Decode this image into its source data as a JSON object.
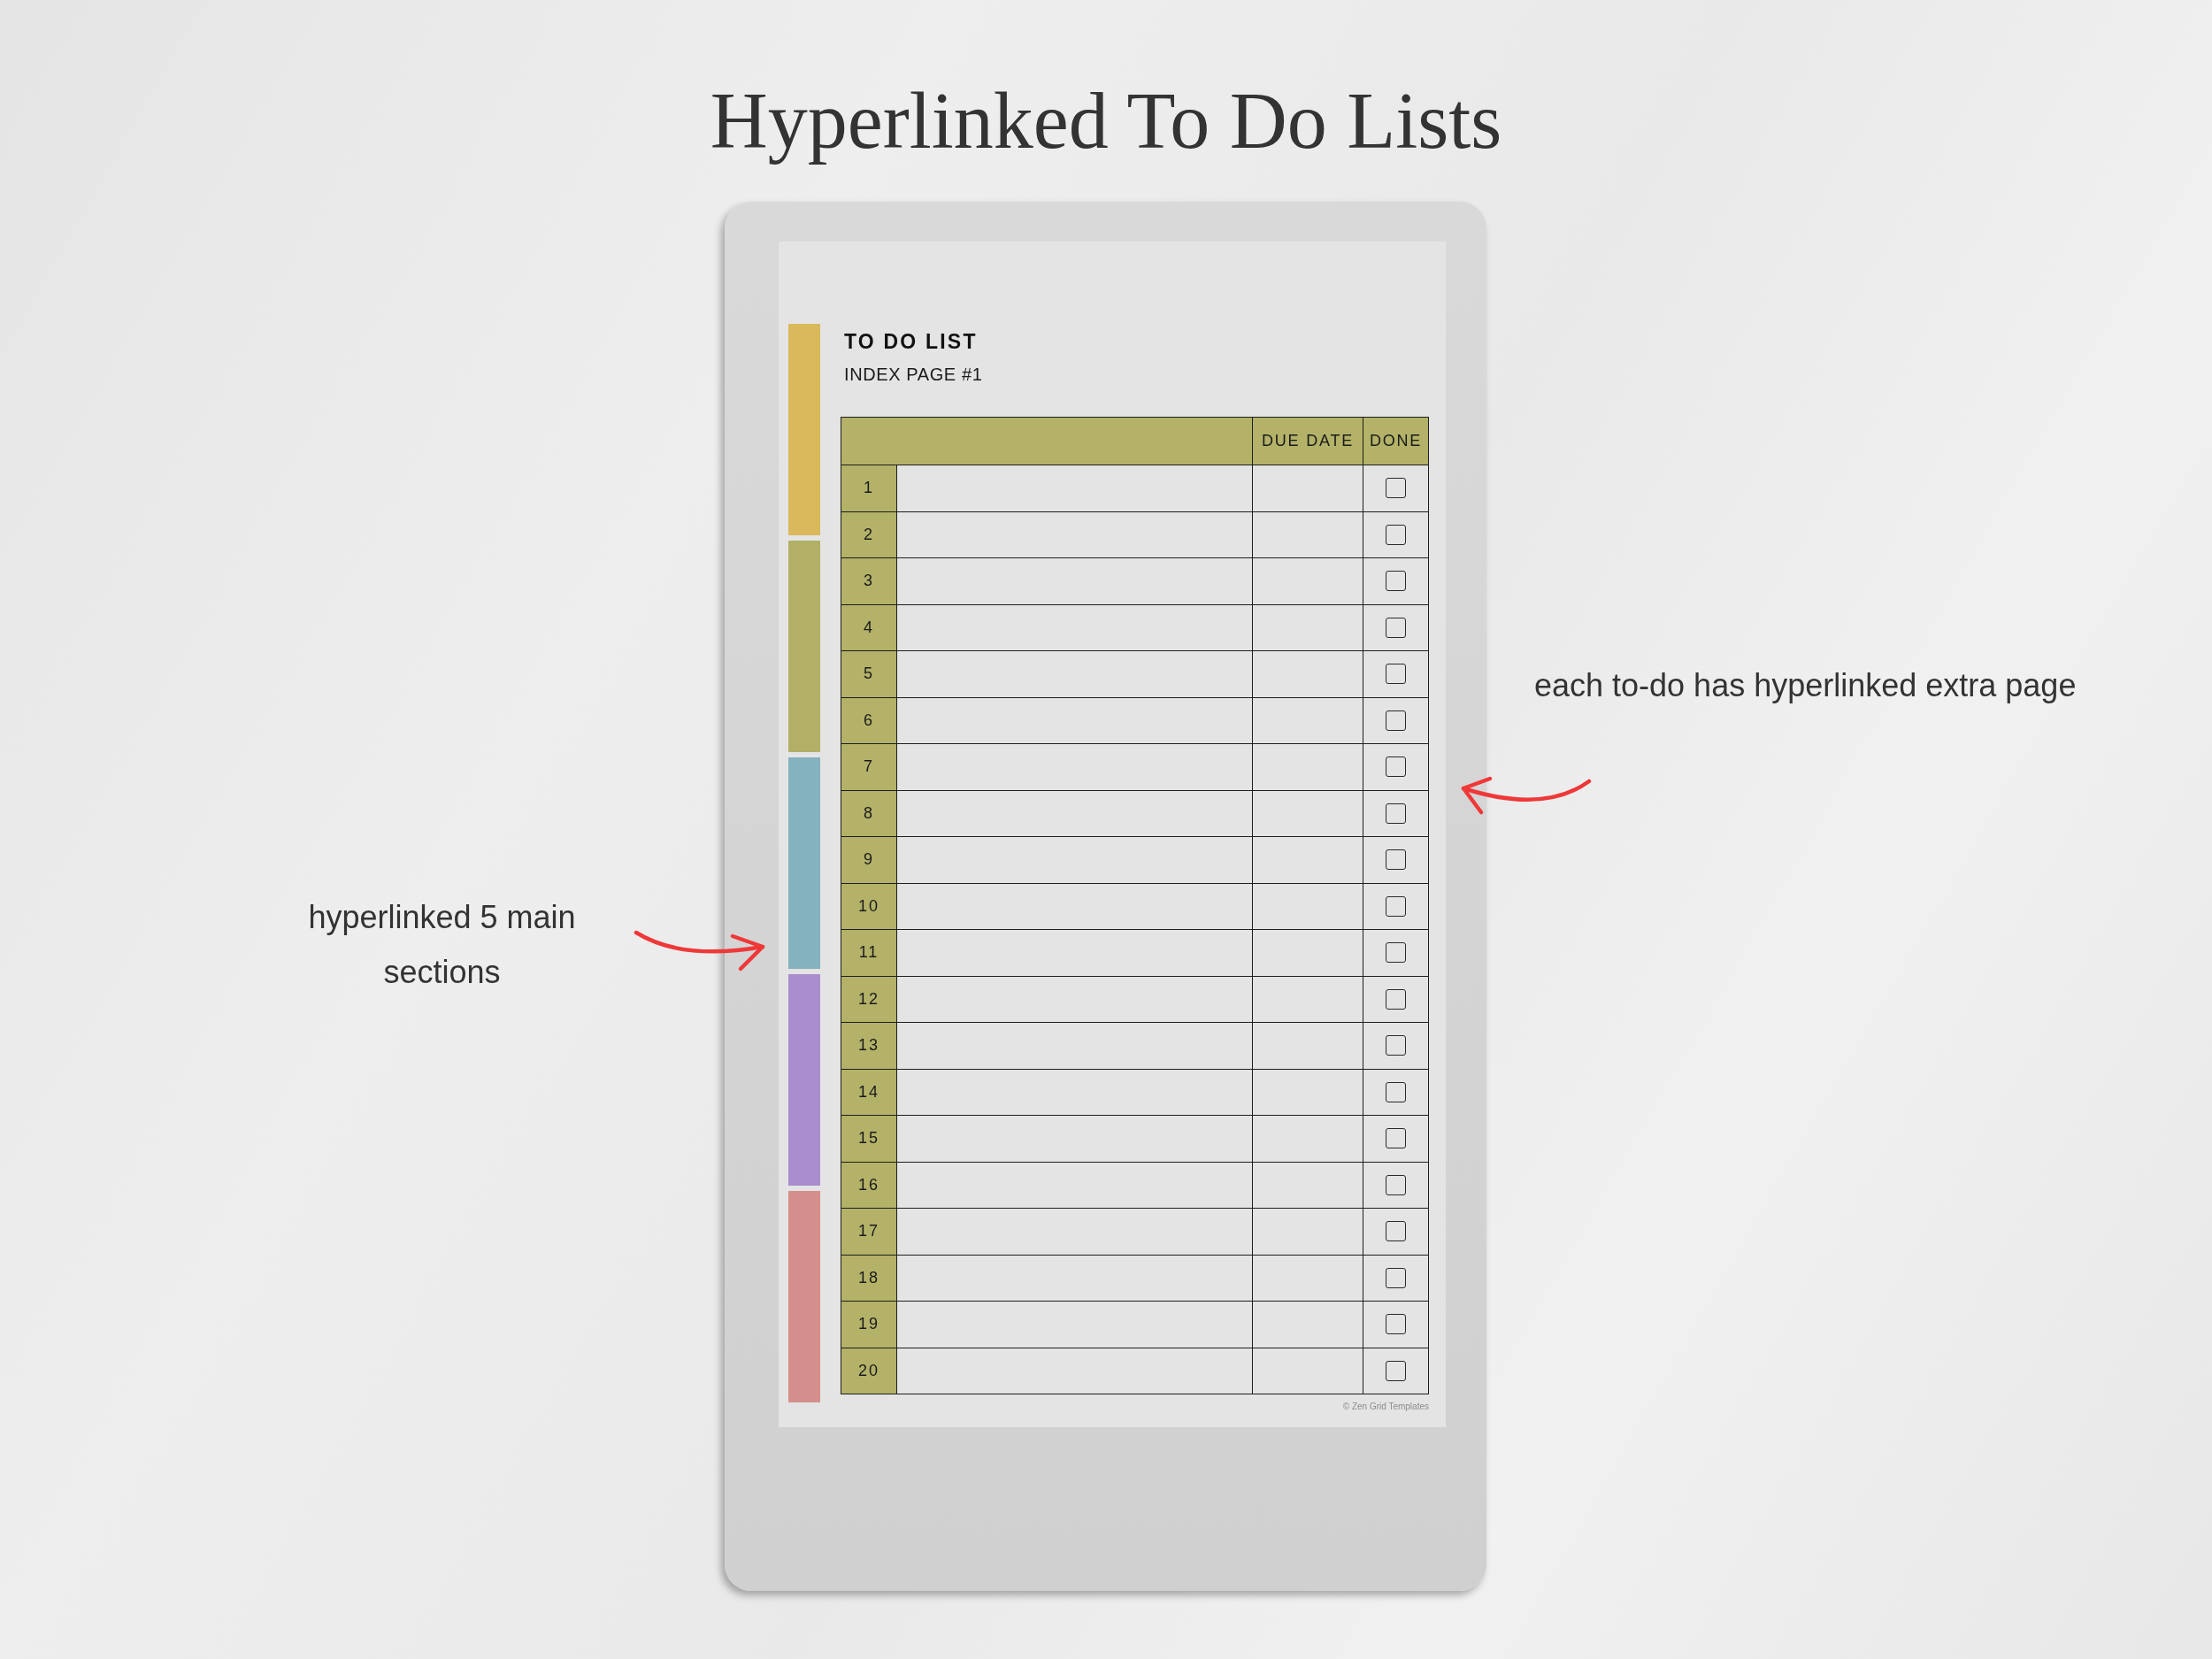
{
  "title": "Hyperlinked To Do Lists",
  "left_annotation": {
    "text": "hyperlinked 5 main sections"
  },
  "right_annotation": {
    "text": "each to-do has hyperlinked extra page"
  },
  "planner_page": {
    "section_tabs": [
      {
        "color": "#dab95c"
      },
      {
        "color": "#b1b066"
      },
      {
        "color": "#84b2be"
      },
      {
        "color": "#a98dcf"
      },
      {
        "color": "#d48e8c"
      }
    ],
    "heading": "TO DO LIST",
    "subheading": "INDEX PAGE #1",
    "table": {
      "column_headers": [
        "DUE DATE",
        "DONE"
      ],
      "rows": [
        {
          "number": "1",
          "done": false
        },
        {
          "number": "2",
          "done": false
        },
        {
          "number": "3",
          "done": false
        },
        {
          "number": "4",
          "done": false
        },
        {
          "number": "5",
          "done": false
        },
        {
          "number": "6",
          "done": false
        },
        {
          "number": "7",
          "done": false
        },
        {
          "number": "8",
          "done": false
        },
        {
          "number": "9",
          "done": false
        },
        {
          "number": "10",
          "done": false
        },
        {
          "number": "11",
          "done": false
        },
        {
          "number": "12",
          "done": false
        },
        {
          "number": "13",
          "done": false
        },
        {
          "number": "14",
          "done": false
        },
        {
          "number": "15",
          "done": false
        },
        {
          "number": "16",
          "done": false
        },
        {
          "number": "17",
          "done": false
        },
        {
          "number": "18",
          "done": false
        },
        {
          "number": "19",
          "done": false
        },
        {
          "number": "20",
          "done": false
        }
      ]
    },
    "footer": "© Zen Grid Templates"
  }
}
